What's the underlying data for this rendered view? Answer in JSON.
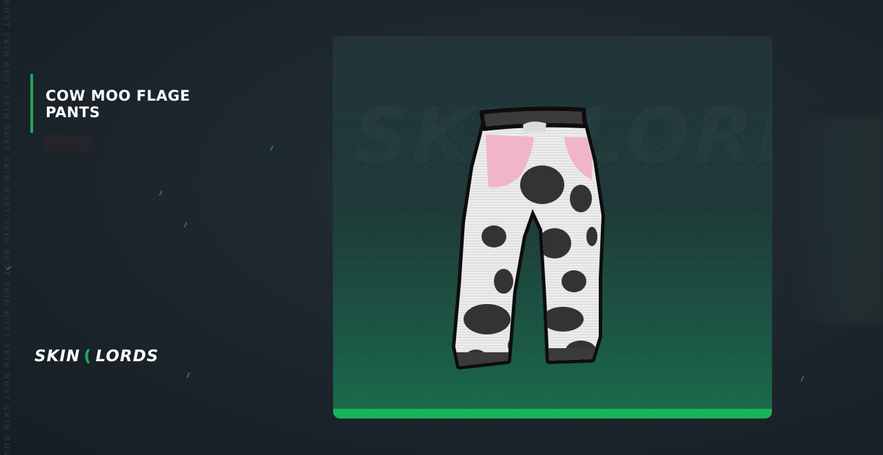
{
  "item": {
    "title": "COW MOO FLAGE PANTS"
  },
  "brand": {
    "logo_left": "SKIN",
    "logo_right": "LORDS",
    "accent_color": "#1ea85b"
  },
  "side_watermark": "RUST SKIN RUST SKIN RUST SKIN RUST SKIN RUST SKIN RUST SKIN RUST SKIN RUST SKIN",
  "icons": [
    "item-preview-image"
  ]
}
